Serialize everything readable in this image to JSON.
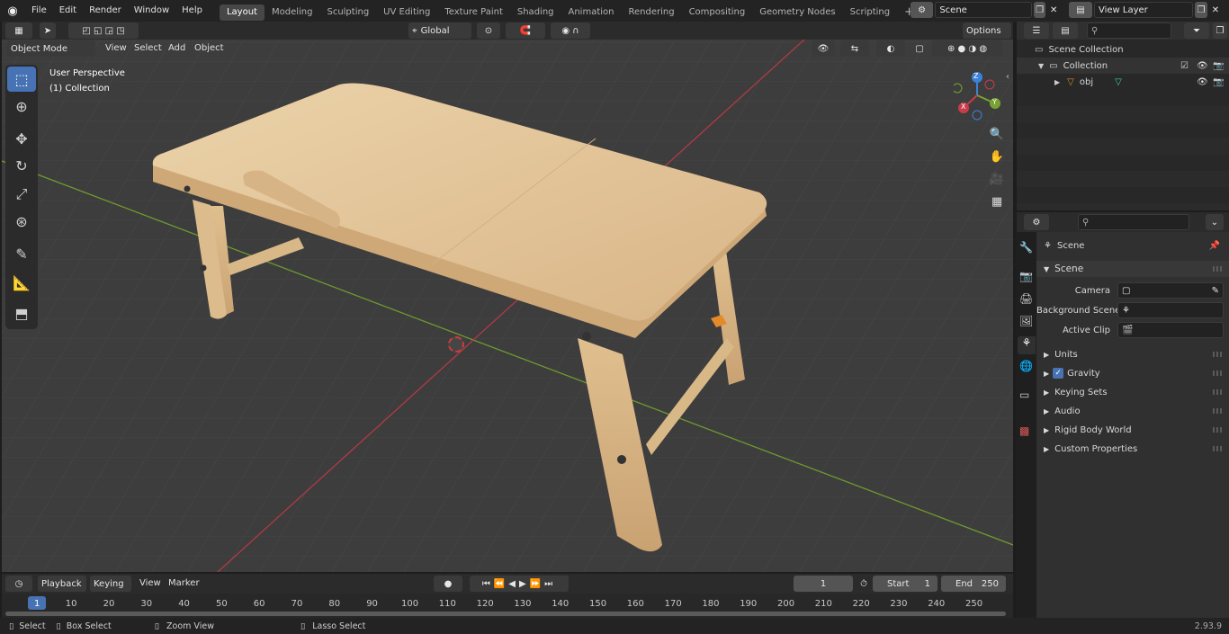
{
  "top_menu": {
    "items": [
      "File",
      "Edit",
      "Render",
      "Window",
      "Help"
    ]
  },
  "workspaces": {
    "tabs": [
      "Layout",
      "Modeling",
      "Sculpting",
      "UV Editing",
      "Texture Paint",
      "Shading",
      "Animation",
      "Rendering",
      "Compositing",
      "Geometry Nodes",
      "Scripting"
    ],
    "active": "Layout"
  },
  "scene_selector": {
    "value": "Scene"
  },
  "view_layer_selector": {
    "value": "View Layer"
  },
  "viewport_header": {
    "mode": "Object Mode",
    "menus": [
      "View",
      "Select",
      "Add",
      "Object"
    ],
    "transform_orientation": "Global",
    "options_label": "Options"
  },
  "viewport": {
    "perspective_label": "User Perspective",
    "collection_label": "(1) Collection",
    "gizmo_axes": [
      "X",
      "Y",
      "Z"
    ]
  },
  "outliner": {
    "search_placeholder": "",
    "scene_collection": "Scene Collection",
    "collection": "Collection",
    "object": "obj"
  },
  "properties": {
    "context": "Scene",
    "panel_title": "Scene",
    "camera_label": "Camera",
    "background_scene_label": "Background Scene",
    "active_clip_label": "Active Clip",
    "subpanels": [
      "Units",
      "Gravity",
      "Keying Sets",
      "Audio",
      "Rigid Body World",
      "Custom Properties"
    ],
    "gravity_checked": true
  },
  "timeline": {
    "menus": [
      "Playback",
      "Keying",
      "View",
      "Marker"
    ],
    "current_frame": "1",
    "start_label": "Start",
    "start_value": "1",
    "end_label": "End",
    "end_value": "250",
    "ticks": [
      "1",
      "10",
      "20",
      "30",
      "40",
      "50",
      "60",
      "70",
      "80",
      "90",
      "100",
      "110",
      "120",
      "130",
      "140",
      "150",
      "160",
      "170",
      "180",
      "190",
      "200",
      "210",
      "220",
      "230",
      "240",
      "250"
    ]
  },
  "status_bar": {
    "select": "Select",
    "box_select": "Box Select",
    "zoom_view": "Zoom View",
    "lasso_select": "Lasso Select",
    "version": "2.93.9"
  },
  "colors": {
    "accent": "#4772b3",
    "x_axis": "#c93c49",
    "y_axis": "#7aa232",
    "z_axis": "#3b82d8",
    "wood": "#e8c99c"
  }
}
